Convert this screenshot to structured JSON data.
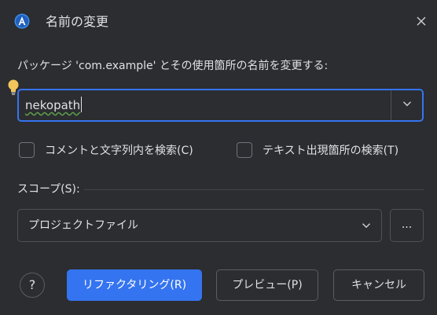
{
  "window": {
    "title": "名前の変更",
    "close_icon": "close-icon",
    "app_icon": "android-studio-icon"
  },
  "prompt": {
    "text": "パッケージ 'com.example' とその使用箇所の名前を変更する:"
  },
  "name_field": {
    "value": "nekopath",
    "dropdown_icon": "chevron-down-icon",
    "hint_icon": "lightbulb-icon"
  },
  "options": {
    "search_comments": {
      "label": "コメントと文字列内を検索(C)",
      "checked": false
    },
    "search_text": {
      "label": "テキスト出現箇所の検索(T)",
      "checked": false
    }
  },
  "scope": {
    "label": "スコープ(S):",
    "selected": "プロジェクトファイル",
    "more_label": "..."
  },
  "buttons": {
    "help": "?",
    "refactor": "リファクタリング(R)",
    "preview": "プレビュー(P)",
    "cancel": "キャンセル"
  },
  "colors": {
    "background": "#2b2d30",
    "accent": "#3574f0",
    "text": "#dfe1e5",
    "hint_bulb": "#f2c55c"
  }
}
